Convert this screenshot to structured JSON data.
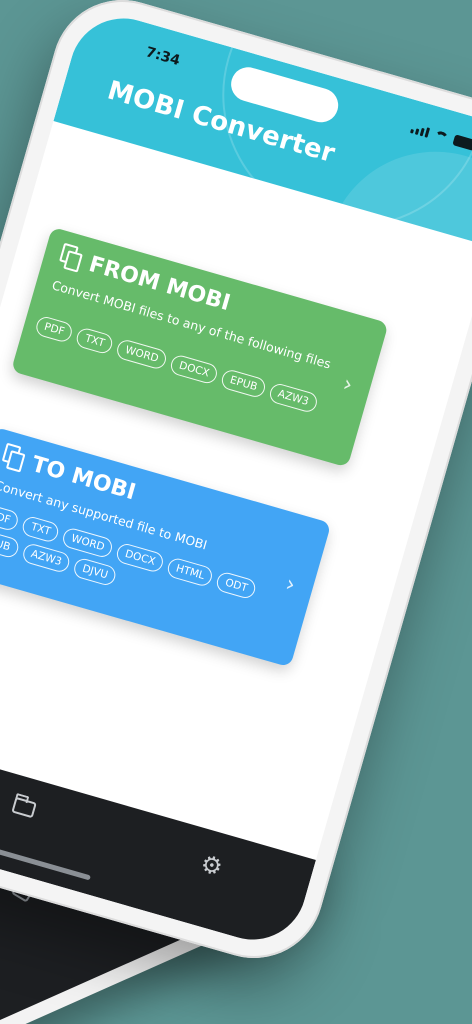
{
  "status_bar": {
    "time": "7:34"
  },
  "header": {
    "title": "MOBI Converter"
  },
  "cards": [
    {
      "title": "FROM MOBI",
      "description": "Convert MOBI files to any of the following files",
      "formats": [
        "PDF",
        "TXT",
        "WORD",
        "DOCX",
        "EPUB",
        "AZW3"
      ],
      "color": "#66bb6a"
    },
    {
      "title": "TO MOBI",
      "description": "Convert any supported file to MOBI",
      "formats": [
        "PDF",
        "TXT",
        "WORD",
        "DOCX",
        "HTML",
        "ODT",
        "EPUB",
        "AZW3",
        "DJVU"
      ],
      "color": "#42a5f5"
    }
  ],
  "tabbar": {
    "items": [
      "folder-icon",
      "gear-icon"
    ]
  },
  "colors": {
    "background": "#5c9694",
    "header": "#36c1d8",
    "tabbar": "#1d1f22"
  }
}
